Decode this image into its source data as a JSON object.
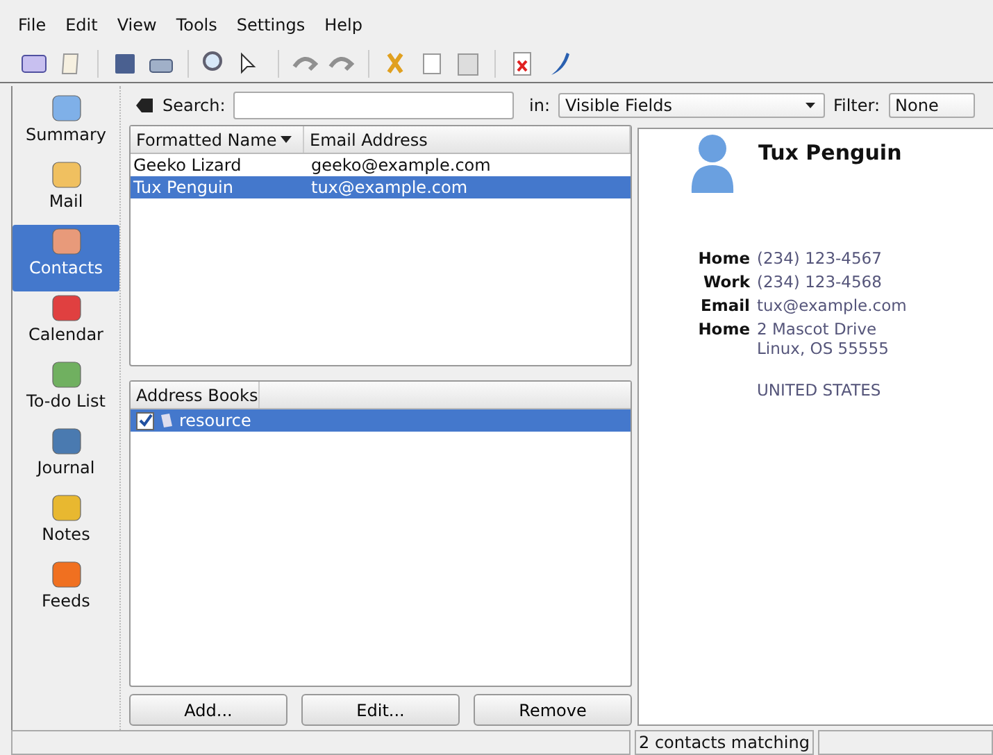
{
  "menu": [
    "File",
    "Edit",
    "View",
    "Tools",
    "Settings",
    "Help"
  ],
  "sidebar": {
    "items": [
      {
        "label": "Summary",
        "selected": false
      },
      {
        "label": "Mail",
        "selected": false
      },
      {
        "label": "Contacts",
        "selected": true
      },
      {
        "label": "Calendar",
        "selected": false
      },
      {
        "label": "To-do List",
        "selected": false
      },
      {
        "label": "Journal",
        "selected": false
      },
      {
        "label": "Notes",
        "selected": false
      },
      {
        "label": "Feeds",
        "selected": false
      }
    ]
  },
  "search": {
    "label": "Search:",
    "in_label": "in:",
    "in_value": "Visible Fields",
    "filter_label": "Filter:",
    "filter_value": "None"
  },
  "contacts_table": {
    "columns": [
      "Formatted Name",
      "Email Address"
    ],
    "rows": [
      {
        "cells": [
          "Geeko Lizard",
          "geeko@example.com"
        ],
        "selected": false
      },
      {
        "cells": [
          "Tux Penguin",
          "tux@example.com"
        ],
        "selected": true
      }
    ]
  },
  "address_books": {
    "header": "Address Books",
    "items": [
      {
        "label": "resource",
        "checked": true,
        "selected": true
      }
    ]
  },
  "buttons": [
    "Add...",
    "Edit...",
    "Remove"
  ],
  "details": {
    "name": "Tux Penguin",
    "fields": [
      {
        "label": "Home",
        "lines": [
          "(234) 123-4567"
        ]
      },
      {
        "label": "Work",
        "lines": [
          "(234) 123-4568"
        ]
      },
      {
        "label": "Email",
        "lines": [
          "tux@example.com"
        ]
      },
      {
        "label": "Home",
        "lines": [
          "2 Mascot Drive",
          "Linux, OS 55555"
        ],
        "country": "UNITED STATES"
      }
    ]
  },
  "status_bar": {
    "count": "2 contacts matching"
  }
}
